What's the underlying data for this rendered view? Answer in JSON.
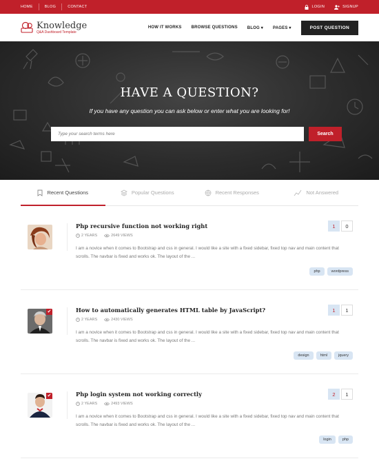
{
  "topbar": {
    "links": [
      "HOME",
      "BLOG",
      "CONTACT"
    ],
    "login": "LOGIN",
    "signup": "SIGNUP"
  },
  "header": {
    "logo_name": "Knowledge",
    "logo_tag": "Q&A Dashboard Template",
    "nav": [
      "HOW IT WORKS",
      "BROWSE QUESTIONS",
      "BLOG ▾",
      "PAGES ▾"
    ],
    "post_button": "POST QUESTION"
  },
  "hero": {
    "title": "HAVE A QUESTION?",
    "subtitle": "If you have any question you can ask below or enter what you are looking for!",
    "search_placeholder": "Type your search terms here",
    "search_button": "Search"
  },
  "tabs": [
    "Recent Questions",
    "Popular Questions",
    "Recent Responses",
    "Not Answered"
  ],
  "questions": [
    {
      "title": "Php recursive function not working right",
      "age": "2 YEARS",
      "views": "2649 VIEWS",
      "excerpt": "I am a novice when it comes to Bootstrap and css in general. I would like a site with a fixed sidebar, fixed top nav and main content that scrolls. The navbar is fixed and works ok. The layout of the ...",
      "votes": "1",
      "answers": "0",
      "tags": [
        "php",
        "wordpress"
      ]
    },
    {
      "title": "How to automatically generates HTML table by JavaScript?",
      "age": "2 YEARS",
      "views": "2430 VIEWS",
      "excerpt": "I am a novice when it comes to Bootstrap and css in general. I would like a site with a fixed sidebar, fixed top nav and main content that scrolls. The navbar is fixed and works ok. The layout of the ...",
      "votes": "1",
      "answers": "1",
      "tags": [
        "design",
        "html",
        "jquery"
      ]
    },
    {
      "title": "Php login system not working correctly",
      "age": "2 YEARS",
      "views": "2493 VIEWS",
      "excerpt": "I am a novice when it comes to Bootstrap and css in general. I would like a site with a fixed sidebar, fixed top nav and main content that scrolls. The navbar is fixed and works ok. The layout of the ...",
      "votes": "2",
      "answers": "1",
      "tags": [
        "login",
        "php"
      ]
    }
  ],
  "colors": {
    "accent": "#c0202a",
    "dark": "#222222",
    "tag_bg": "#d8e5f3"
  },
  "icons": [
    "lock-icon",
    "user-plus-icon",
    "logo-icon",
    "clock-icon",
    "eye-icon",
    "bookmark-icon",
    "layers-icon",
    "globe-icon",
    "trend-icon",
    "check-icon"
  ]
}
